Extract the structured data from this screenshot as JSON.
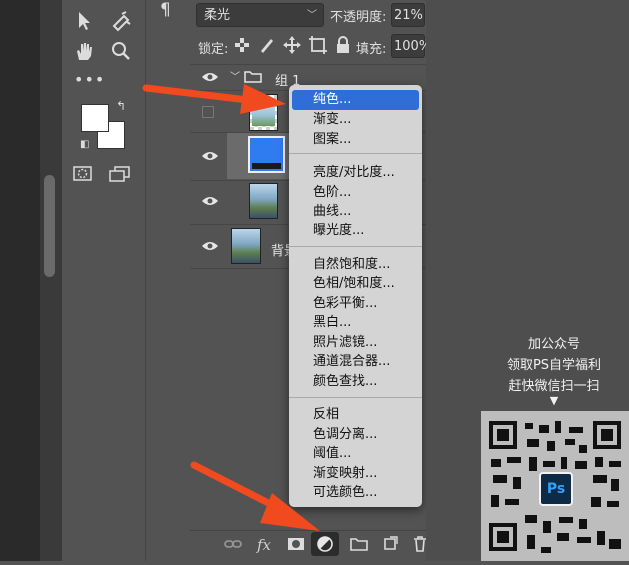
{
  "layers_panel": {
    "blend_mode": "柔光",
    "opacity_label": "不透明度:",
    "opacity_value": "21%",
    "lock_label": "锁定:",
    "fill_label": "填充:",
    "fill_value": "100%",
    "group_name": "组 1",
    "bg_layer_name": "背景",
    "solid_color_thumb": "#2f7bf0"
  },
  "mini_panel": {
    "paragraph_icon": "¶"
  },
  "context_menu": {
    "section1": [
      "纯色...",
      "渐变...",
      "图案..."
    ],
    "section2": [
      "亮度/对比度...",
      "色阶...",
      "曲线...",
      "曝光度..."
    ],
    "section3": [
      "自然饱和度...",
      "色相/饱和度...",
      "色彩平衡...",
      "黑白...",
      "照片滤镜...",
      "通道混合器...",
      "颜色查找..."
    ],
    "section4": [
      "反相",
      "色调分离...",
      "阈值...",
      "渐变映射...",
      "可选颜色..."
    ],
    "highlight_color": "#2f6ed6"
  },
  "bottom_bar": {
    "fx_label": "fx"
  },
  "promo": {
    "line1": "加公众号",
    "line2": "领取PS自学福利",
    "line3": "赶快微信扫一扫",
    "arrow": "▼",
    "qr_badge": "Ps"
  },
  "annotation_arrow_color": "#f04a1e"
}
